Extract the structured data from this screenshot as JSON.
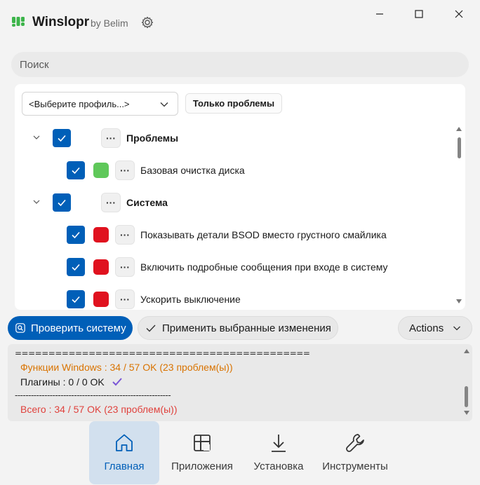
{
  "app": {
    "name": "Winslopr",
    "by": "by Belim"
  },
  "search": {
    "placeholder": "Поиск"
  },
  "toolbar": {
    "profile_placeholder": "<Выберите профиль...>",
    "only_problems_label": "Только проблемы"
  },
  "tree": {
    "rows": [
      {
        "type": "group",
        "label": "Проблемы",
        "checked": true,
        "expanded": true
      },
      {
        "type": "item",
        "label": "Базовая очистка диска",
        "checked": true,
        "status": "green"
      },
      {
        "type": "group",
        "label": "Система",
        "checked": true,
        "expanded": true
      },
      {
        "type": "item",
        "label": "Показывать детали BSOD вместо грустного смайлика",
        "checked": true,
        "status": "red"
      },
      {
        "type": "item",
        "label": "Включить подробные сообщения при входе в систему",
        "checked": true,
        "status": "red"
      },
      {
        "type": "item",
        "label": "Ускорить выключение",
        "checked": true,
        "status": "red"
      }
    ],
    "more_label": "···"
  },
  "actions": {
    "check_label": "Проверить систему",
    "apply_label": "Применить выбранные изменения",
    "actions_label": "Actions"
  },
  "log": {
    "sep_long": "============================================",
    "windows_features": "Функции Windows : 34 / 57 OK  (23 проблем(ы))",
    "plugins": "Плагины : 0 / 0 OK",
    "sep_short": "----------------------------------------------------------",
    "total": "Всего : 34 / 57 OK  (23 проблем(ы))"
  },
  "nav": {
    "items": [
      {
        "label": "Главная",
        "icon": "home-icon",
        "active": true
      },
      {
        "label": "Приложения",
        "icon": "apps-icon",
        "active": false
      },
      {
        "label": "Установка",
        "icon": "download-icon",
        "active": false
      },
      {
        "label": "Инструменты",
        "icon": "wrench-icon",
        "active": false
      }
    ]
  },
  "colors": {
    "accent": "#005fb8",
    "status_green": "#5fc85a",
    "status_red": "#e0121f",
    "log_orange": "#d97300",
    "log_red": "#e0413c"
  }
}
